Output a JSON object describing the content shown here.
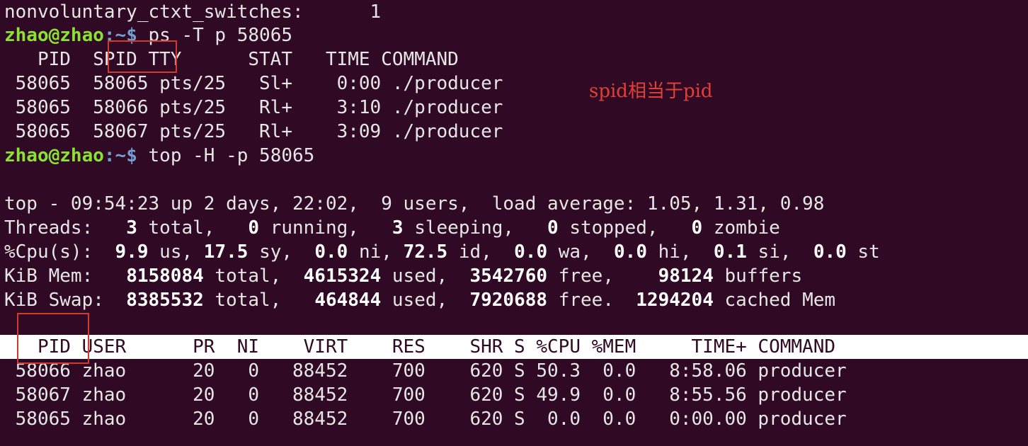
{
  "lines": [
    "nonvoluntary_ctxt_switches:      1"
  ],
  "prompt": {
    "user_host": "zhao@zhao",
    "path": ":~$"
  },
  "commands": [
    " ps -T p 58065",
    " top -H -p 58065"
  ],
  "ps": {
    "header": "   PID  SPID TTY      STAT   TIME COMMAND",
    "rows": [
      " 58065  58065 pts/25   Sl+    0:00 ./producer",
      " 58065  58066 pts/25   Rl+    3:10 ./producer",
      " 58065  58067 pts/25   Rl+    3:09 ./producer"
    ]
  },
  "annotation": "spid相当于pid",
  "top": {
    "summary": "top - 09:54:23 up 2 days, 22:02,  9 users,  load average: 1.05, 1.31, 0.98",
    "threads": [
      "Threads:   ",
      "3",
      " total,   ",
      "0",
      " running,   ",
      "3",
      " sleeping,   ",
      "0",
      " stopped,   ",
      "0",
      " zombie"
    ],
    "cpu": [
      "%Cpu(s):  ",
      "9.9",
      " us, ",
      "17.5",
      " sy,  ",
      "0.0",
      " ni, ",
      "72.5",
      " id,  ",
      "0.0",
      " wa,  ",
      "0.0",
      " hi,  ",
      "0.1",
      " si,  ",
      "0.0",
      " st"
    ],
    "mem": [
      "KiB Mem:   ",
      "8158084",
      " total,  ",
      "4615324",
      " used,  ",
      "3542760",
      " free,    ",
      "98124",
      " buffers"
    ],
    "swap": [
      "KiB Swap:  ",
      "8385532",
      " total,   ",
      "464844",
      " used,  ",
      "7920688",
      " free.  ",
      "1294204",
      " cached Mem"
    ],
    "table_header": "   PID USER      PR  NI    VIRT    RES    SHR S %CPU %MEM     TIME+ COMMAND",
    "rows": [
      " 58066 zhao      20   0   88452    700    620 S 50.3  0.0   8:58.06 producer",
      " 58067 zhao      20   0   88452    700    620 S 49.9  0.0   8:55.56 producer",
      " 58065 zhao      20   0   88452    700    620 S  0.0  0.0   0:00.00 producer"
    ]
  }
}
